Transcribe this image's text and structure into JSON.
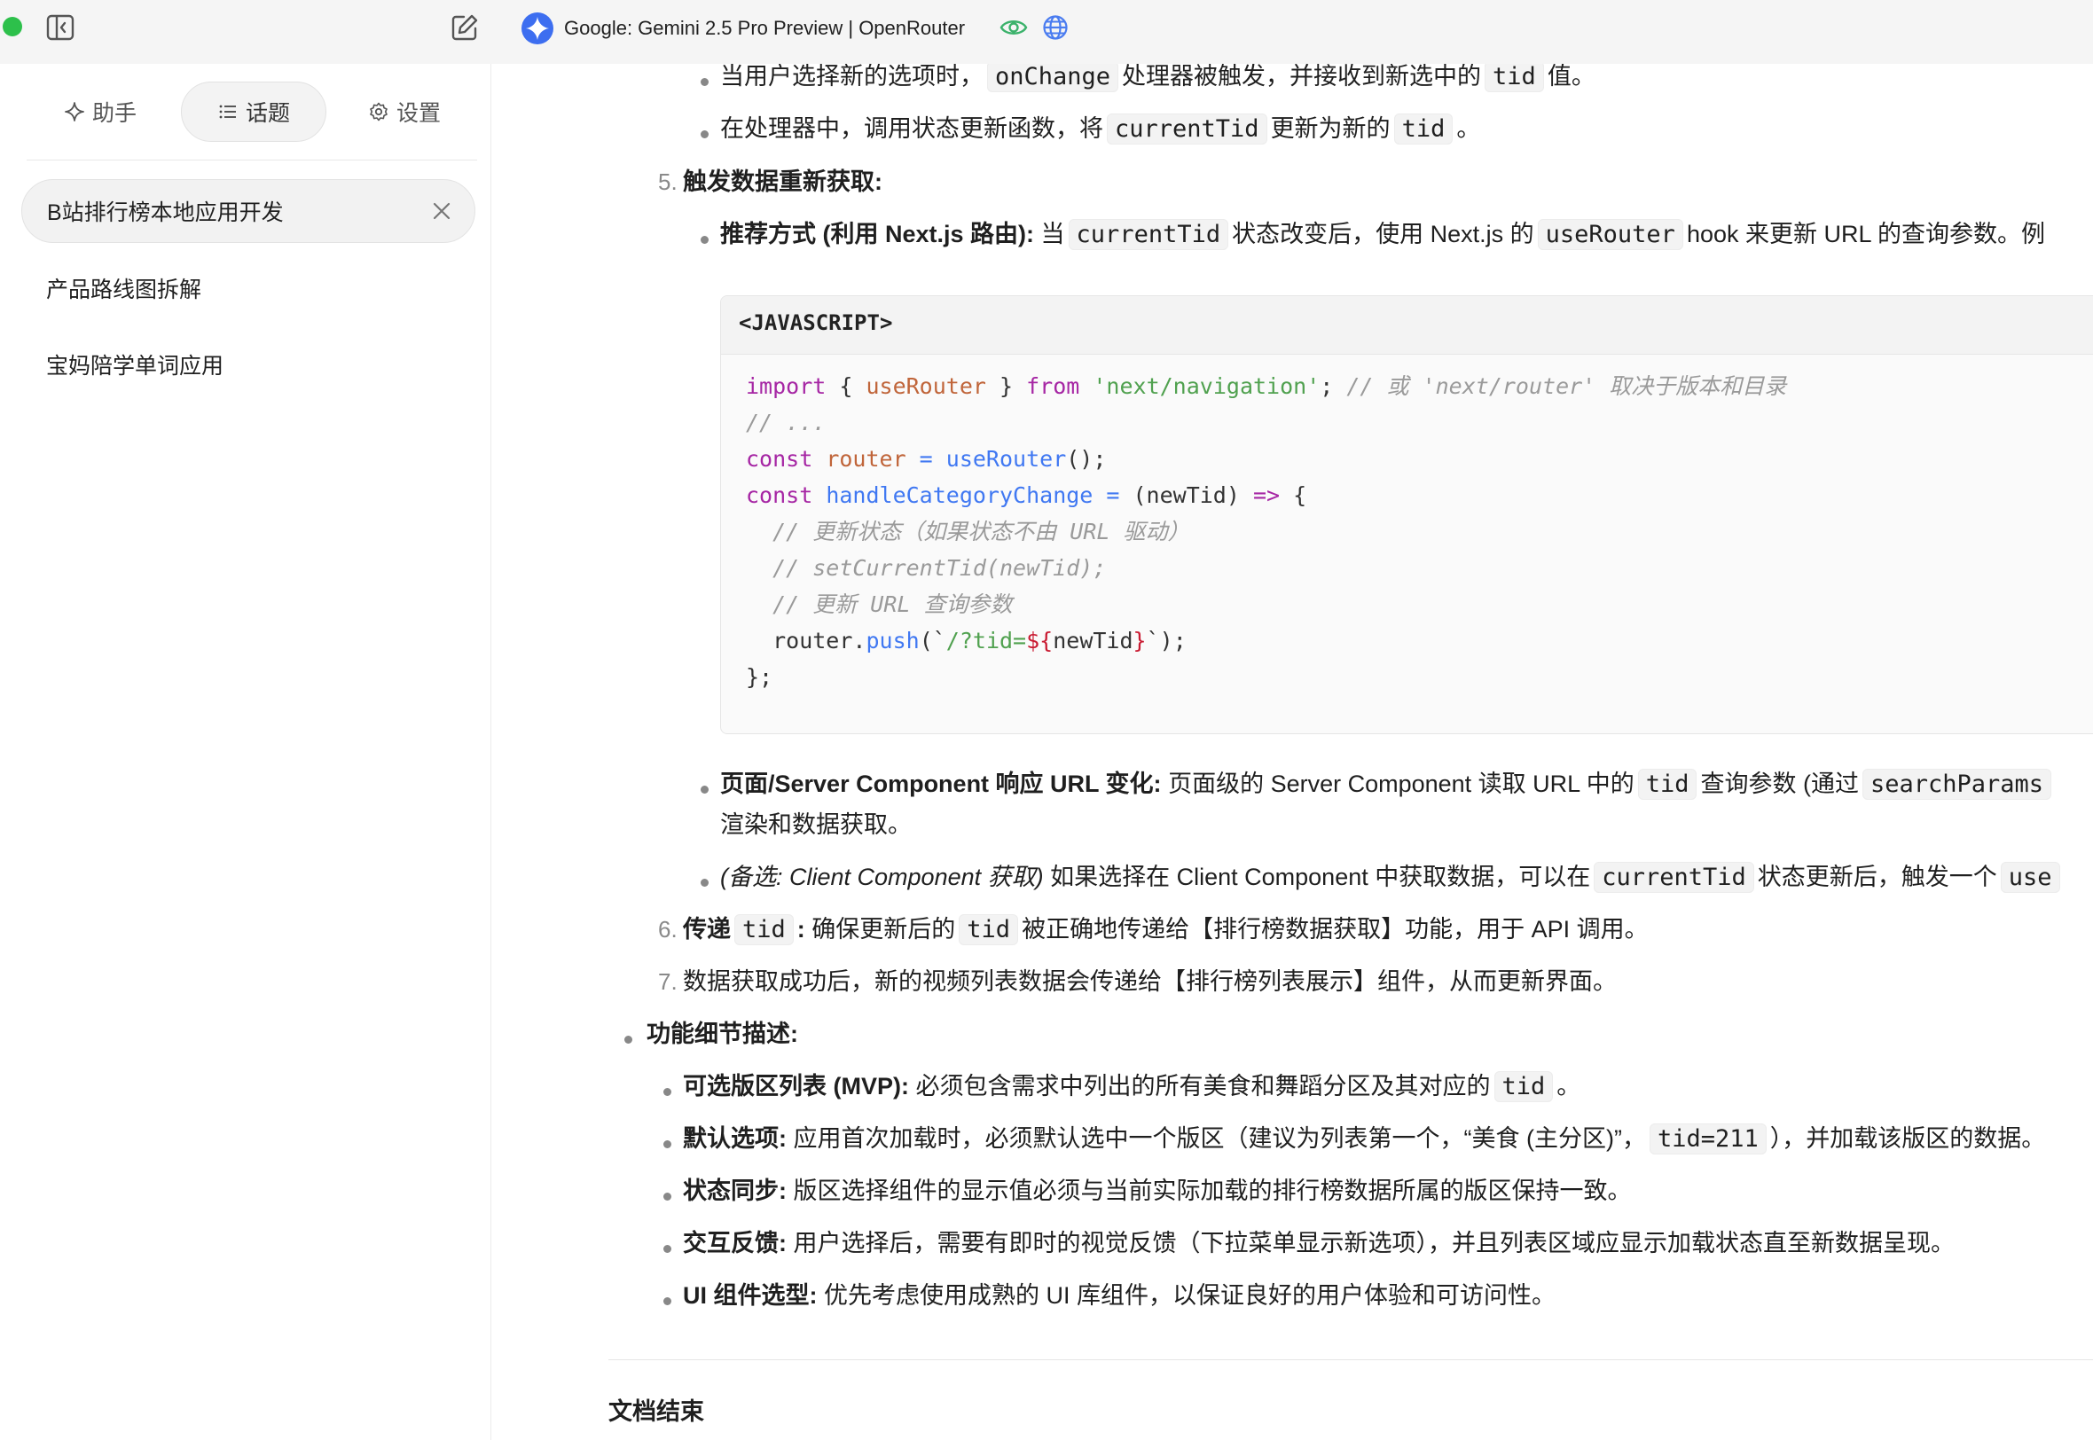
{
  "topbar": {
    "model_title": "Google: Gemini 2.5 Pro Preview | OpenRouter",
    "accent_color": "#3d6ef0",
    "icons": [
      "sidebar-toggle-icon",
      "edit-icon",
      "gemini-logo-icon",
      "eye-icon",
      "globe-icon"
    ]
  },
  "sidebar": {
    "tabs": [
      {
        "label": "助手",
        "icon": "sparkle-icon"
      },
      {
        "label": "话题",
        "icon": "list-icon",
        "active": true
      },
      {
        "label": "设置",
        "icon": "gear-icon"
      }
    ],
    "topics": [
      {
        "label": "B站排行榜本地应用开发",
        "active": true
      },
      {
        "label": "产品路线图拆解"
      },
      {
        "label": "宝妈陪学单词应用"
      }
    ]
  },
  "content": {
    "l1": {
      "a": "当用户选择新的选项时，",
      "c1": "onChange",
      "b": "处理器被触发，并接收到新选中的",
      "c2": "tid",
      "d": "值。"
    },
    "l2": {
      "a": "在处理器中，调用状态更新函数，将",
      "c1": "currentTid",
      "b": "更新为新的",
      "c2": "tid",
      "d": "。"
    },
    "step5": {
      "num": "5.",
      "title": "触发数据重新获取:"
    },
    "l3": {
      "bold": "推荐方式 (利用 Next.js 路由):",
      "a": " 当",
      "c1": "currentTid",
      "b": "状态改变后，使用 Next.js 的",
      "c2": "useRouter",
      "d": "hook 来更新 URL 的查询参数。例"
    },
    "code": {
      "lang": "<JAVASCRIPT>",
      "import_kw": "import",
      "brace_open": " { ",
      "import_name": "useRouter",
      "brace_close": " } ",
      "from_kw": "from",
      "module": "'next/navigation'",
      "semicolon": ";",
      "import_comment": " // 或 'next/router' 取决于版本和目录",
      "ellipsis": "// ...",
      "const1": "const",
      "router_var": " router",
      "eq1": " = ",
      "use_router_call": "useRouter",
      "call_end": "();",
      "const2": "const",
      "handler_name": " handleCategoryChange",
      "eq2": " = ",
      "params": "(newTid) ",
      "arrow": "=>",
      "body_open": " {",
      "comment1": "  // 更新状态（如果状态不由 URL 驱动）",
      "comment2": "  // setCurrentTid(newTid);",
      "comment3": "  // 更新 URL 查询参数",
      "push_obj": "  router.",
      "push_fn": "push",
      "push_open": "(`",
      "push_path": "/?tid=",
      "interp_open": "${",
      "interp_var": "newTid",
      "interp_close": "}",
      "push_close": "`);",
      "body_close": "};"
    },
    "l4": {
      "bold": "页面/Server Component 响应 URL 变化:",
      "a": " 页面级的 Server Component 读取 URL 中的",
      "c1": "tid",
      "b": "查询参数 (通过",
      "c2": "searchParams",
      "cont": "渲染和数据获取。"
    },
    "l5": {
      "ital": "(备选: Client Component 获取)",
      "a": " 如果选择在 Client Component 中获取数据，可以在",
      "c1": "currentTid",
      "b": "状态更新后，触发一个",
      "c2": "use"
    },
    "step6": {
      "num": "6.",
      "bold": "传递",
      "c1": "tid",
      "colon": ":",
      "a": " 确保更新后的",
      "c2": "tid",
      "b": "被正确地传递给【排行榜数据获取】功能，用于 API 调用。"
    },
    "step7": {
      "num": "7.",
      "a": "数据获取成功后，新的视频列表数据会传递给【排行榜列表展示】组件，从而更新界面。"
    },
    "details_title": "功能细节描述:",
    "d1": {
      "bold": "可选版区列表 (MVP):",
      "a": " 必须包含需求中列出的所有美食和舞蹈分区及其对应的",
      "c1": "tid",
      "b": "。"
    },
    "d2": {
      "bold": "默认选项:",
      "a": " 应用首次加载时，必须默认选中一个版区（建议为列表第一个，“美食 (主分区)”，",
      "c1": "tid=211",
      "b": "），并加载该版区的数据。"
    },
    "d3": {
      "bold": "状态同步:",
      "a": " 版区选择组件的显示值必须与当前实际加载的排行榜数据所属的版区保持一致。"
    },
    "d4": {
      "bold": "交互反馈:",
      "a": " 用户选择后，需要有即时的视觉反馈（下拉菜单显示新选项），并且列表区域应显示加载状态直至新数据呈现。"
    },
    "d5": {
      "bold": "UI 组件选型:",
      "a": " 优先考虑使用成熟的 UI 库组件，以保证良好的用户体验和可访问性。"
    },
    "doc_end": "文档结束"
  }
}
